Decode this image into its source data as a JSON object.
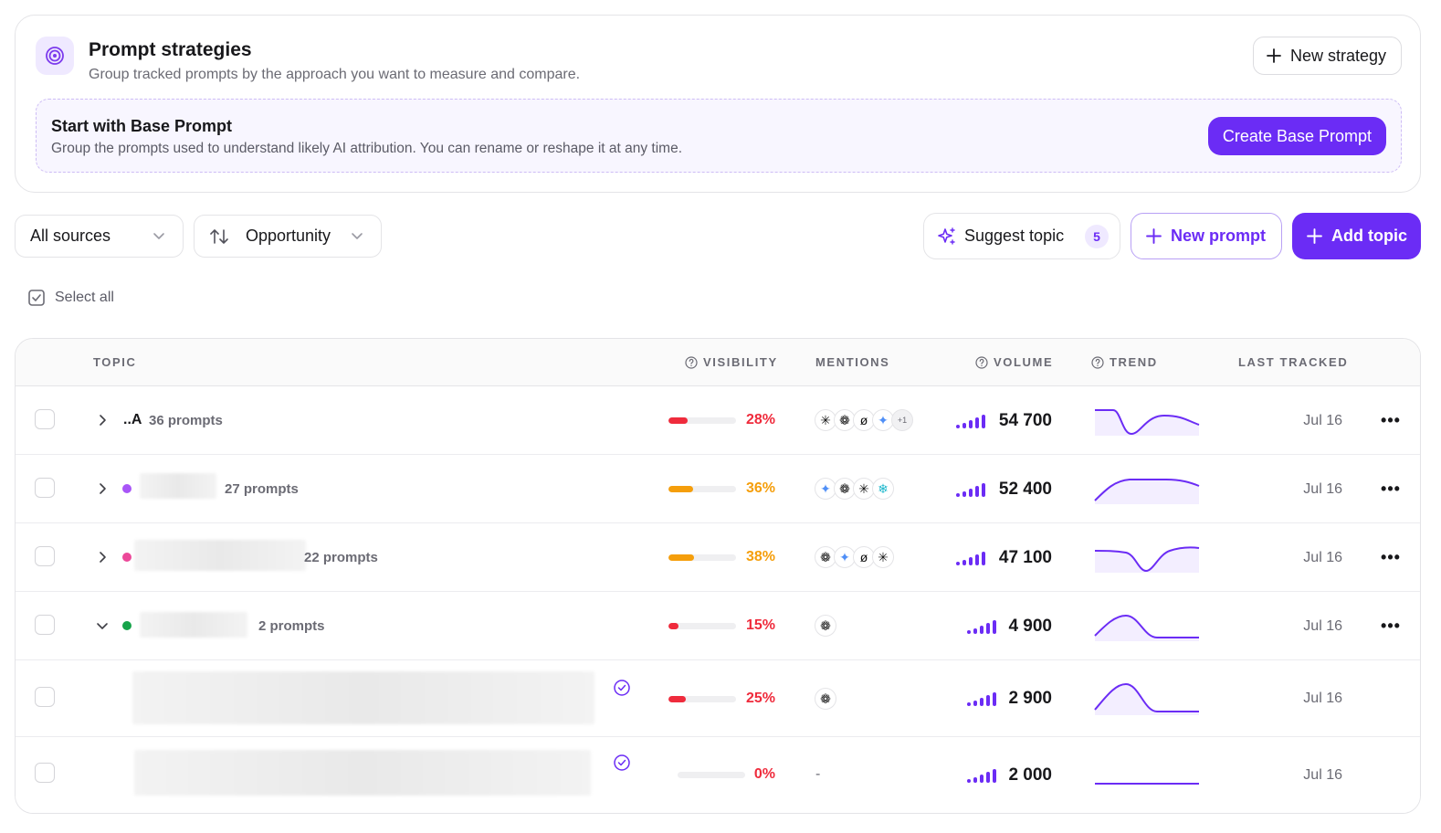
{
  "strategies": {
    "title": "Prompt strategies",
    "subtitle": "Group tracked prompts by the approach you want to measure and compare.",
    "new_strategy_label": "New strategy",
    "base": {
      "title": "Start with Base Prompt",
      "subtitle": "Group the prompts used to understand likely AI attribution. You can rename or reshape it at any time.",
      "create_label": "Create Base Prompt"
    }
  },
  "toolbar": {
    "sources_value": "All sources",
    "sort_value": "Opportunity",
    "suggest_label": "Suggest topic",
    "suggest_count": "5",
    "new_prompt_label": "New prompt",
    "add_topic_label": "Add topic",
    "select_all_label": "Select all"
  },
  "table": {
    "columns": {
      "topic": "TOPIC",
      "visibility": "VISIBILITY",
      "mentions": "MENTIONS",
      "volume": "VOLUME",
      "trend": "TREND",
      "last_tracked": "LAST TRACKED"
    },
    "rows": [
      {
        "topic_glyph": "..A",
        "prompts": "36 prompts",
        "visibility": "28%",
        "visibility_value": 0.28,
        "volume": "54 700",
        "last_tracked": "Jul 16",
        "mentions_more": "+1"
      },
      {
        "prompts": "27 prompts",
        "visibility": "36%",
        "visibility_value": 0.36,
        "volume": "52 400",
        "last_tracked": "Jul 16"
      },
      {
        "prompts": "22 prompts",
        "visibility": "38%",
        "visibility_value": 0.38,
        "volume": "47 100",
        "last_tracked": "Jul 16"
      },
      {
        "prompts": "2 prompts",
        "visibility": "15%",
        "visibility_value": 0.15,
        "volume": "4 900",
        "last_tracked": "Jul 16"
      },
      {
        "visibility": "25%",
        "visibility_value": 0.25,
        "volume": "2 900",
        "last_tracked": "Jul 16"
      },
      {
        "visibility": "0%",
        "visibility_value": 0.0,
        "mentions_empty": "-",
        "volume": "2 000",
        "last_tracked": "Jul 16"
      }
    ]
  },
  "colors": {
    "accent": "#6b2cf5",
    "red": "#ef2b3c",
    "orange": "#f59e0b",
    "dot_purple": "#a855f7",
    "dot_pink": "#ec4899",
    "dot_green": "#16a34a"
  },
  "icons": [
    "target-icon",
    "plus-icon",
    "chevron-down-icon",
    "sort-arrows-icon",
    "sparkle-icon",
    "checkbox-icon",
    "help-circle-icon",
    "chevron-right-icon",
    "more-horizontal-icon",
    "verified-check-icon",
    "openai-icon",
    "claude-icon",
    "gemini-icon",
    "perplexity-icon",
    "grok-icon"
  ]
}
